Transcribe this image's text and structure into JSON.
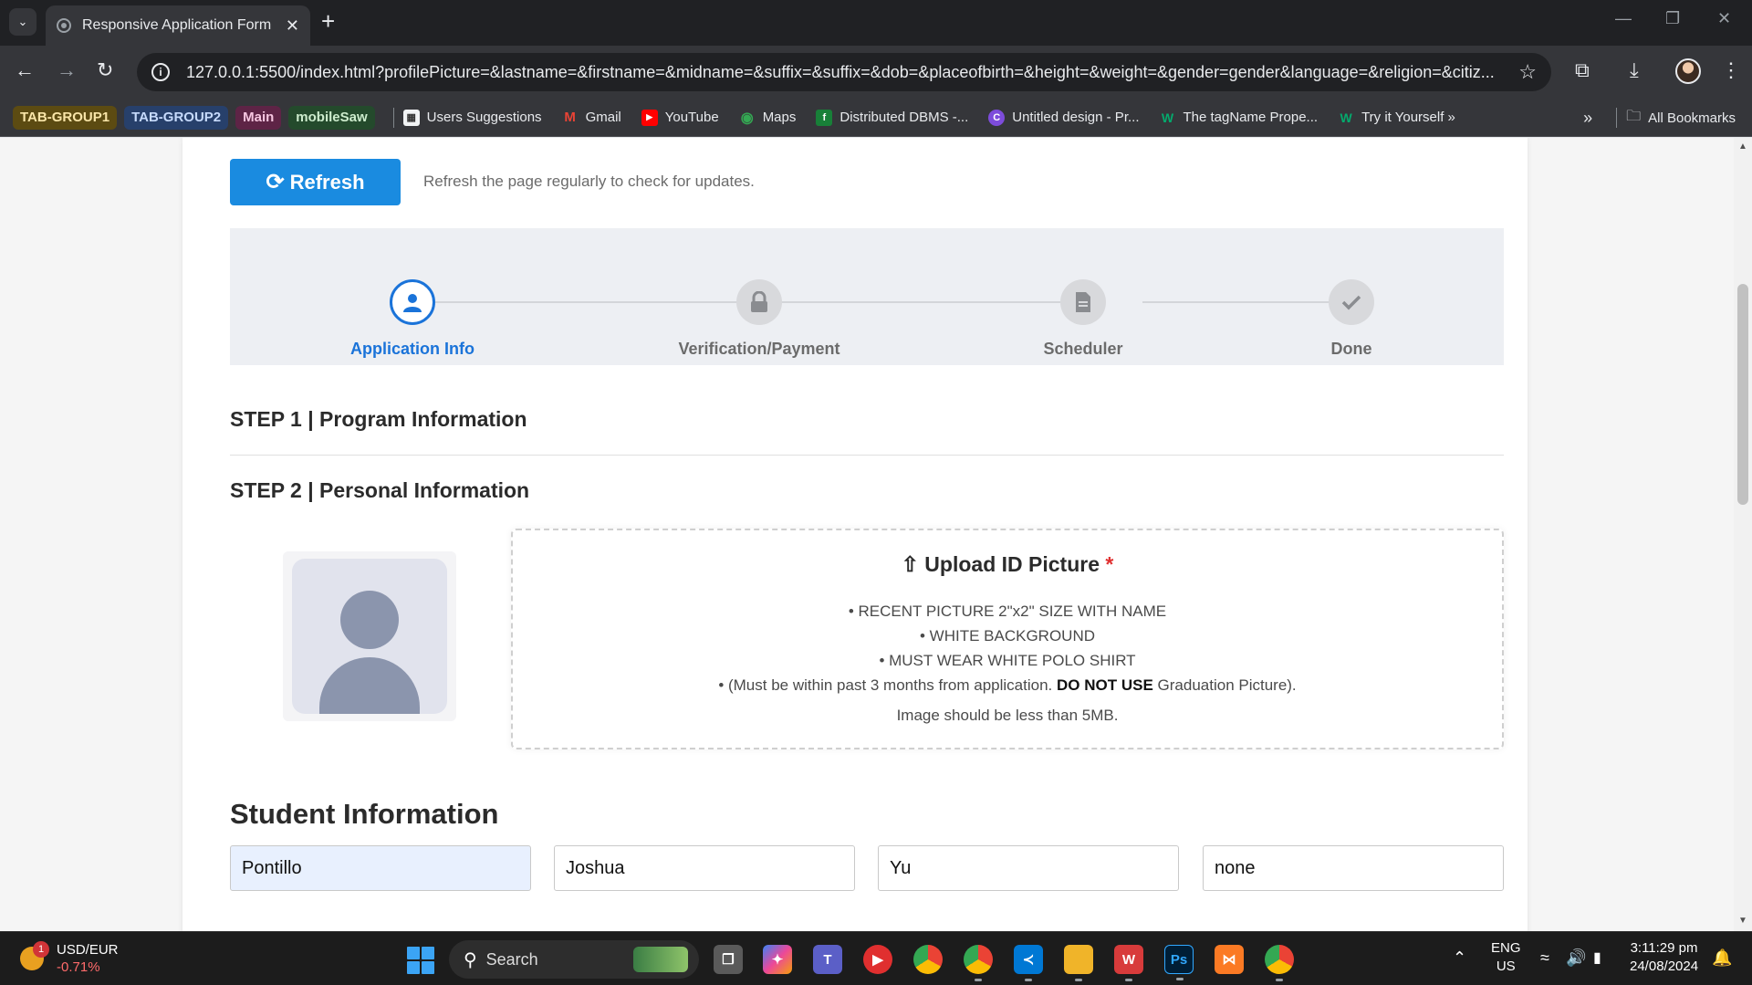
{
  "browser": {
    "tab_title": "Responsive Application Form",
    "url": "127.0.0.1:5500/index.html?profilePicture=&lastname=&firstname=&midname=&suffix=&suffix=&dob=&placeofbirth=&height=&weight=&gender=gender&language=&religion=&citiz...",
    "tab_groups": [
      {
        "label": "TAB-GROUP1",
        "color": "#f9e5a8",
        "bg": "#5c4b12"
      },
      {
        "label": "TAB-GROUP2",
        "color": "#c6dafc",
        "bg": "#27406b"
      },
      {
        "label": "Main",
        "color": "#f6c6e0",
        "bg": "#5e2446"
      },
      {
        "label": "mobileSaw",
        "color": "#cdeccd",
        "bg": "#244a2c"
      }
    ],
    "bookmarks": [
      {
        "label": "Users Suggestions",
        "icon": "users-suggestions-icon"
      },
      {
        "label": "Gmail",
        "icon": "gmail-icon"
      },
      {
        "label": "YouTube",
        "icon": "youtube-icon"
      },
      {
        "label": "Maps",
        "icon": "maps-icon"
      },
      {
        "label": "Distributed DBMS -...",
        "icon": "distributed-dbms-icon"
      },
      {
        "label": "Untitled design - Pr...",
        "icon": "canva-icon"
      },
      {
        "label": "The tagName Prope...",
        "icon": "w3schools-icon"
      },
      {
        "label": "Try it Yourself »",
        "icon": "w3schools-icon"
      }
    ],
    "all_bookmarks": "All Bookmarks"
  },
  "page": {
    "refresh_label": "Refresh",
    "refresh_note": "Refresh the page regularly to check for updates.",
    "steps": [
      {
        "label": "Application Info",
        "icon": "user-icon",
        "active": true
      },
      {
        "label": "Verification/Payment",
        "icon": "lock-icon",
        "active": false
      },
      {
        "label": "Scheduler",
        "icon": "document-icon",
        "active": false
      },
      {
        "label": "Done",
        "icon": "check-icon",
        "active": false
      }
    ],
    "step1_title": "STEP 1 | Program Information",
    "step2_title": "STEP 2 | Personal Information",
    "upload": {
      "title": "⇧ Upload ID Picture",
      "required_mark": "*",
      "req1": "• RECENT PICTURE 2\"x2\" SIZE WITH NAME",
      "req2": "• WHITE BACKGROUND",
      "req3": "• MUST WEAR WHITE POLO SHIRT",
      "req4_pre": "• (Must be within past 3 months from application.",
      "req4_bold": "DO NOT USE",
      "req4_post": "Graduation Picture).",
      "size_note": "Image should be less than 5MB."
    },
    "student_title": "Student Information",
    "fields": {
      "lastname": "Pontillo",
      "firstname": "Joshua",
      "midname": "Yu",
      "suffix": "none"
    }
  },
  "taskbar": {
    "ticker_symbol": "USD/EUR",
    "ticker_change": "-0.71%",
    "ticker_badge": "1",
    "search_placeholder": "Search",
    "lang_top": "ENG",
    "lang_bottom": "US",
    "time": "3:11:29 pm",
    "date": "24/08/2024"
  },
  "colors": {
    "accent": "#1a73d9",
    "refresh_button": "#1a8be0",
    "required": "#e03131"
  }
}
